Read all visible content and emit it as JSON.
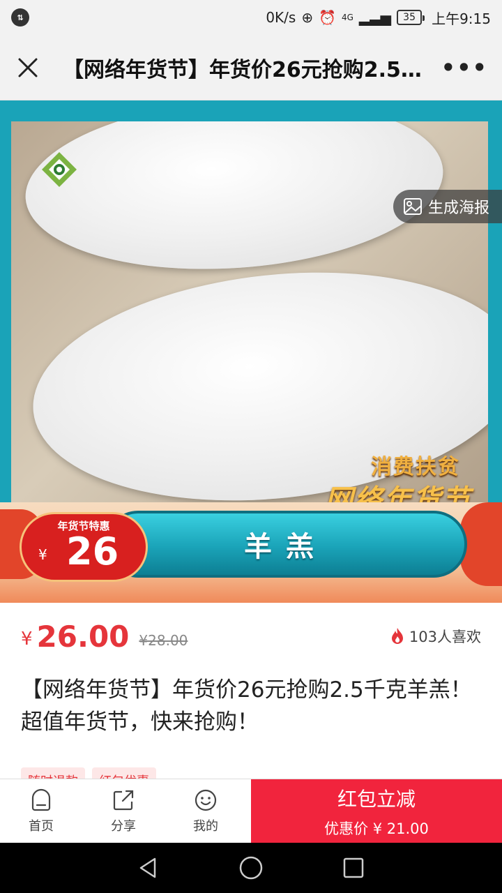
{
  "status_bar": {
    "network_speed": "0K/s",
    "network_type": "4G",
    "battery": "35",
    "time": "上午9:15"
  },
  "title_bar": {
    "title": "【网络年货节】年货价26元抢购2.5…",
    "more_label": "•••"
  },
  "hero": {
    "poster_button": "生成海报",
    "watermark_line1": "消费扶贫",
    "watermark_line2": "网络年货节",
    "badge_label": "年货节特惠",
    "badge_currency": "¥",
    "badge_price": "26",
    "product_name": "羊羔"
  },
  "price": {
    "currency": "¥",
    "current": "26.00",
    "original": "¥28.00",
    "likes": "103人喜欢"
  },
  "description": "【网络年货节】年货价26元抢购2.5千克羊羔！超值年货节，快来抢购！",
  "tags": [
    "随时退款",
    "红包优惠"
  ],
  "bottom_nav": {
    "home": "首页",
    "share": "分享",
    "mine": "我的",
    "buy_title": "红包立减",
    "buy_sub": "优惠价 ¥ 21.00"
  },
  "colors": {
    "accent_red": "#f1243d",
    "price_red": "#e5353b",
    "hero_teal": "#1aa3b8"
  },
  "icons": {
    "close": "close-icon",
    "more": "more-icon",
    "poster": "image-icon",
    "fire": "fire-icon",
    "home": "home-icon",
    "share": "share-icon",
    "mine": "smile-icon",
    "back": "back-triangle-icon",
    "circle": "home-circle-icon",
    "recent": "recent-square-icon"
  }
}
